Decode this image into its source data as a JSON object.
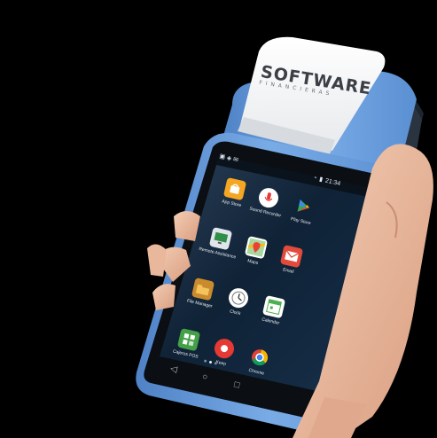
{
  "receipt": {
    "logo_main": "SOFTWARE",
    "logo_sub": "FINANCIERAS"
  },
  "status_bar": {
    "time": "21:34"
  },
  "apps": [
    {
      "label": "App Store",
      "icon": "app-store-icon",
      "color": "#f5a623"
    },
    {
      "label": "Sound Recorder",
      "icon": "microphone-icon",
      "color": "#ffffff"
    },
    {
      "label": "Play Store",
      "icon": "play-store-icon",
      "color": "#ffffff"
    },
    {
      "label": "Remote Assistance",
      "icon": "monitor-icon",
      "color": "#2f8f46"
    },
    {
      "label": "Maps",
      "icon": "maps-icon",
      "color": "#ffffff"
    },
    {
      "label": "Email",
      "icon": "email-icon",
      "color": "#e24b3b"
    },
    {
      "label": "File Manager",
      "icon": "folder-icon",
      "color": "#c98b2e"
    },
    {
      "label": "Clock",
      "icon": "clock-icon",
      "color": "#ffffff"
    },
    {
      "label": "Calendar",
      "icon": "calendar-icon",
      "color": "#4caf50"
    },
    {
      "label": "Cajeros POS",
      "icon": "pos-icon",
      "color": "#43a047"
    },
    {
      "label": "Keep",
      "icon": "record-icon",
      "color": "#e53935"
    },
    {
      "label": "Chrome",
      "icon": "chrome-icon",
      "color": "#ffffff"
    }
  ],
  "colors": {
    "device_blue": "#6fa4e0",
    "screen_bg": "#0d1b2a"
  }
}
